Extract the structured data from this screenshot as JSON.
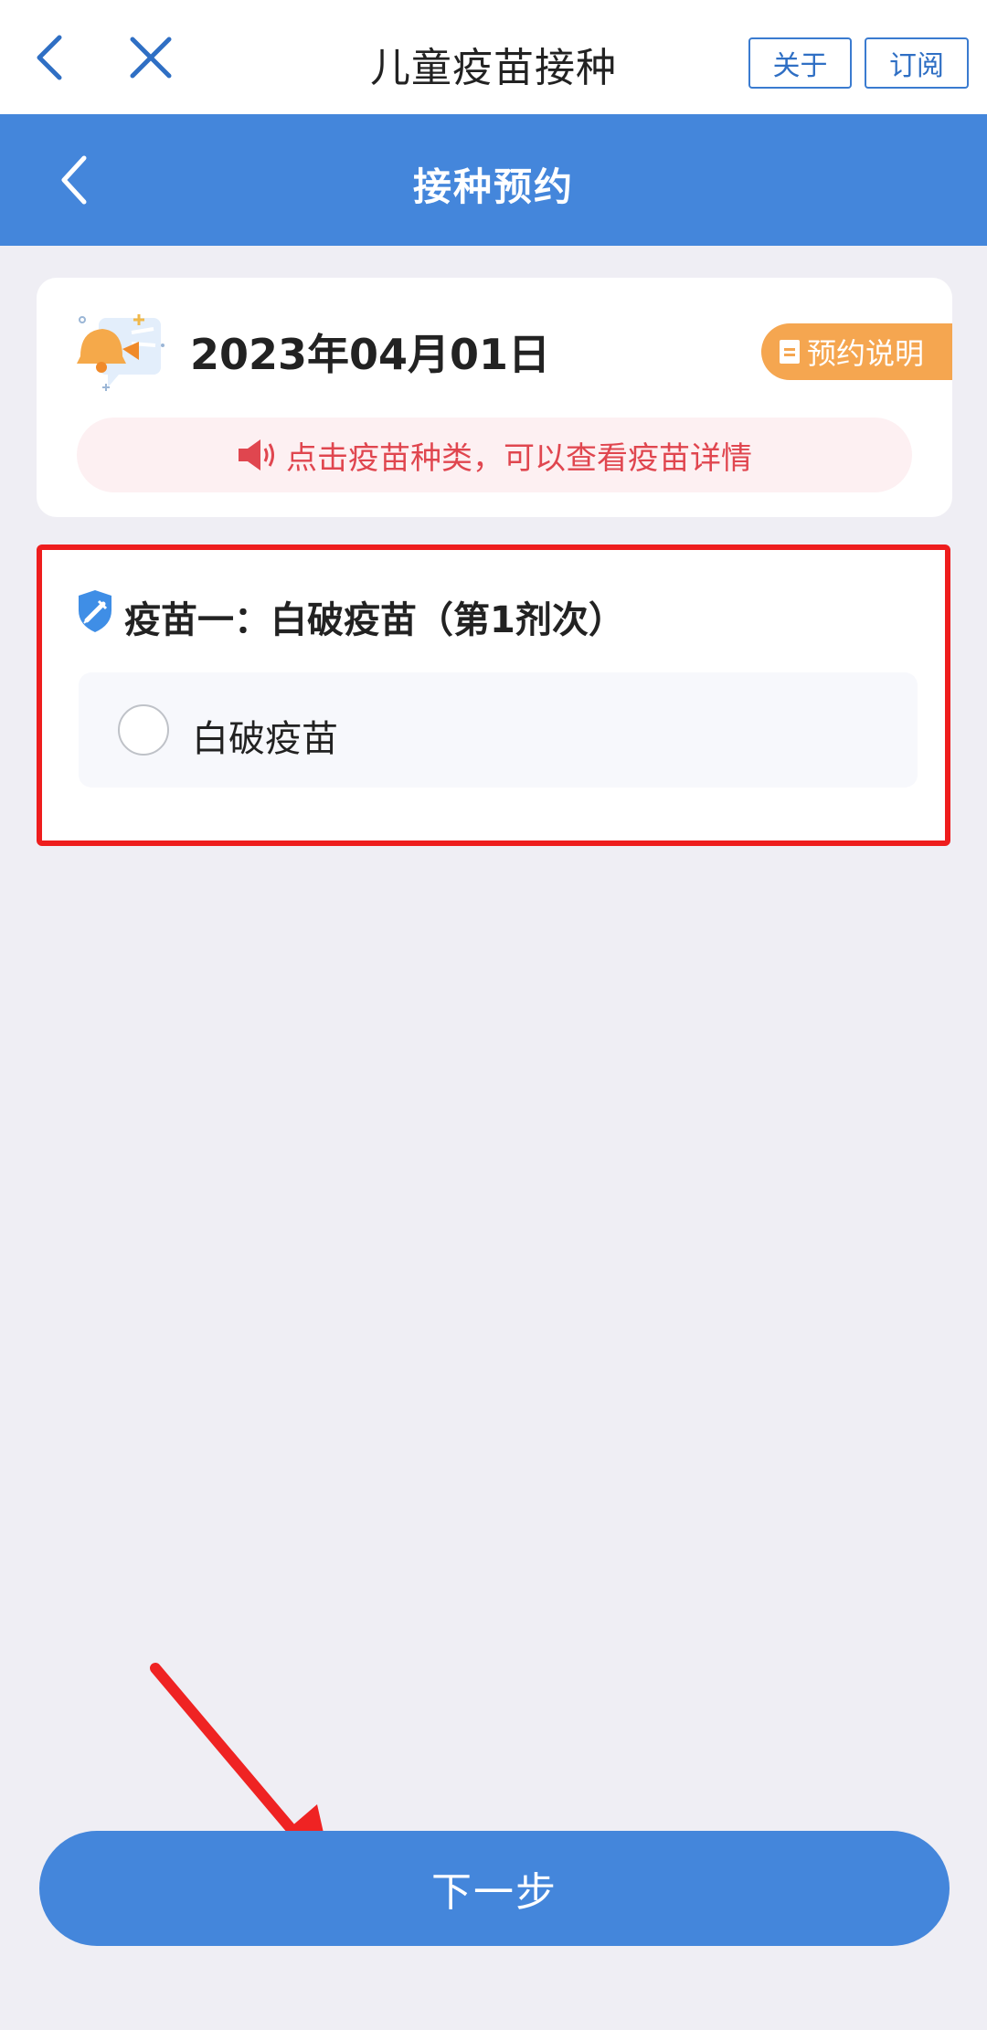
{
  "topbar": {
    "title": "儿童疫苗接种",
    "about_label": "关于",
    "subscribe_label": "订阅"
  },
  "header": {
    "title": "接种预约"
  },
  "info": {
    "date": "2023年04月01日",
    "guide_label": "预约说明",
    "notice": "点击疫苗种类，可以查看疫苗详情"
  },
  "vaccine": {
    "title": "疫苗一：白破疫苗（第1剂次）",
    "options": [
      {
        "label": "白破疫苗",
        "selected": false
      }
    ]
  },
  "footer": {
    "next_label": "下一步"
  },
  "colors": {
    "primary": "#4486db",
    "highlight_border": "#ee1d1d",
    "tag": "#f5a650",
    "notice_text": "#e0464f"
  },
  "icons": {
    "back": "chevron-left-icon",
    "close": "close-icon",
    "bell": "bell-icon",
    "document": "document-icon",
    "speaker": "speaker-icon",
    "shield": "shield-syringe-icon",
    "arrow": "red-arrow-annotation"
  }
}
